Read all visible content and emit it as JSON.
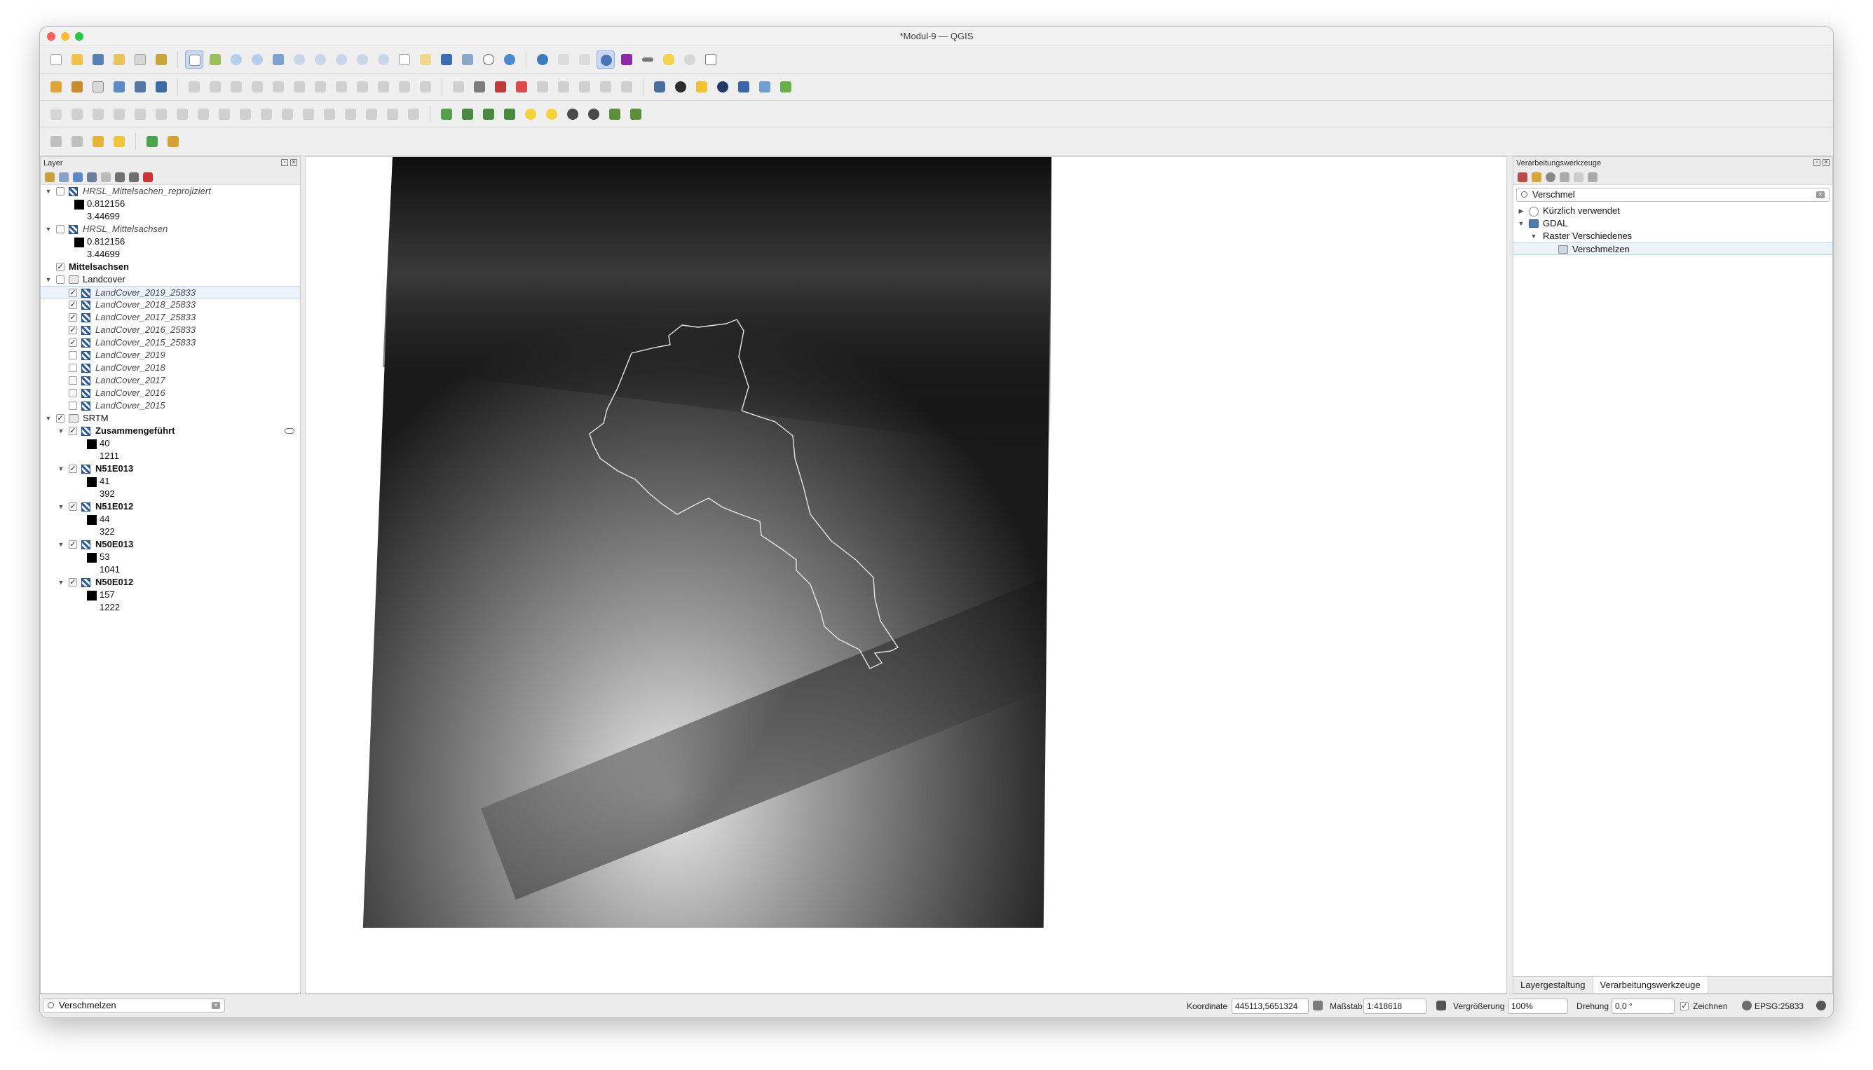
{
  "window": {
    "title": "*Modul-9 — QGIS"
  },
  "colors": {
    "close": "#fe5f57",
    "minimize": "#febc2e",
    "zoom": "#28c840",
    "accent": "#2a5c9c"
  },
  "layers_panel": {
    "title": "Layer",
    "items": [
      {
        "label": "HRSL_Mittelsachen_reprojiziert",
        "checked": false,
        "style": "italic"
      },
      {
        "value": "0.812156"
      },
      {
        "value": "3.44699"
      },
      {
        "label": "HRSL_Mittelsachsen",
        "checked": false,
        "style": "italic"
      },
      {
        "value": "0.812156"
      },
      {
        "value": "3.44699"
      },
      {
        "label": "Mittelsachsen",
        "checked": true,
        "style": "bold"
      },
      {
        "label": "Landcover",
        "checked": false,
        "style": "group"
      },
      {
        "label": "LandCover_2019_25833",
        "checked": true,
        "style": "italic"
      },
      {
        "label": "LandCover_2018_25833",
        "checked": true,
        "style": "italic"
      },
      {
        "label": "LandCover_2017_25833",
        "checked": true,
        "style": "italic"
      },
      {
        "label": "LandCover_2016_25833",
        "checked": true,
        "style": "italic"
      },
      {
        "label": "LandCover_2015_25833",
        "checked": true,
        "style": "italic"
      },
      {
        "label": "LandCover_2019",
        "checked": false,
        "style": "italic"
      },
      {
        "label": "LandCover_2018",
        "checked": false,
        "style": "italic"
      },
      {
        "label": "LandCover_2017",
        "checked": false,
        "style": "italic"
      },
      {
        "label": "LandCover_2016",
        "checked": false,
        "style": "italic"
      },
      {
        "label": "LandCover_2015",
        "checked": false,
        "style": "italic"
      },
      {
        "label": "SRTM",
        "checked": true,
        "style": "group"
      },
      {
        "label": "Zusammengeführt",
        "checked": true,
        "style": "bold"
      },
      {
        "value": "40"
      },
      {
        "value": "1211"
      },
      {
        "label": "N51E013",
        "checked": true,
        "style": "bold"
      },
      {
        "value": "41"
      },
      {
        "value": "392"
      },
      {
        "label": "N51E012",
        "checked": true,
        "style": "bold"
      },
      {
        "value": "44"
      },
      {
        "value": "322"
      },
      {
        "label": "N50E013",
        "checked": true,
        "style": "bold"
      },
      {
        "value": "53"
      },
      {
        "value": "1041"
      },
      {
        "label": "N50E012",
        "checked": true,
        "style": "bold"
      },
      {
        "value": "157"
      },
      {
        "value": "1222"
      }
    ]
  },
  "processing_panel": {
    "title": "Verarbeitungswerkzeuge",
    "search_value": "Verschmel",
    "tree": {
      "recent": "Kürzlich verwendet",
      "provider": "GDAL",
      "group": "Raster Verschiedenes",
      "tool": "Verschmelzen"
    }
  },
  "bottom_tabs": [
    "Layergestaltung",
    "Verarbeitungswerkzeuge"
  ],
  "locator": {
    "value": "Verschmelzen"
  },
  "statusbar": {
    "coord_label": "Koordinate",
    "coord_value": "445113,5651324",
    "scale_label": "Maßstab",
    "scale_value": "1:418618",
    "magnifier_label": "Vergrößerung",
    "magnifier_value": "100%",
    "rotation_label": "Drehung",
    "rotation_value": "0,0 °",
    "render_label": "Zeichnen",
    "crs_label": "EPSG:25833"
  }
}
